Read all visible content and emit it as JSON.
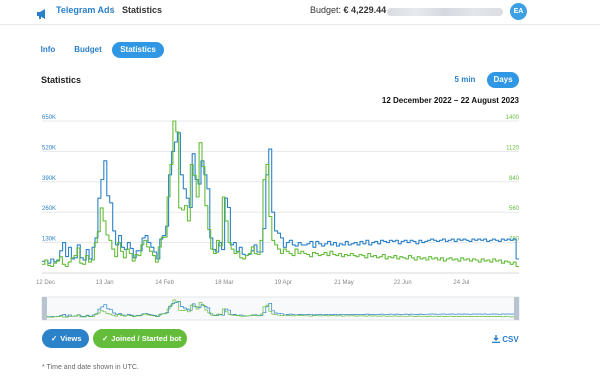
{
  "header": {
    "brand": "Telegram Ads",
    "separator": "/",
    "page": "Statistics",
    "budget_label": "Budget:",
    "budget_value": "€ 4,229.44",
    "avatar_initials": "EA"
  },
  "tabs": [
    {
      "label": "Info",
      "active": false
    },
    {
      "label": "Budget",
      "active": false
    },
    {
      "label": "Statistics",
      "active": true
    }
  ],
  "section_title": "Statistics",
  "granularity": {
    "options": [
      "5 min",
      "Days"
    ],
    "selected": "Days"
  },
  "date_range": "12 December 2022 – 22 August 2023",
  "chart_data": {
    "type": "line",
    "left_axis": {
      "ticks": [
        "130K",
        "260K",
        "390K",
        "520K",
        "650K"
      ],
      "range": [
        0,
        650000
      ],
      "color": "#2b82c9"
    },
    "right_axis": {
      "ticks": [
        "280",
        "560",
        "840",
        "1120",
        "1400"
      ],
      "range": [
        0,
        1400
      ],
      "color": "#64bd3a"
    },
    "x_ticks": [
      "12 Dec",
      "13 Jan",
      "14 Feb",
      "18 Mar",
      "19 Apr",
      "21 May",
      "22 Jun",
      "24 Jul"
    ],
    "grid": true,
    "series": [
      {
        "name": "Views",
        "color": "#2b82c9",
        "axis": "left",
        "values": [
          50000,
          55000,
          42000,
          60000,
          48000,
          55000,
          95000,
          130000,
          70000,
          110000,
          60000,
          65000,
          120000,
          65000,
          55000,
          100000,
          60000,
          110000,
          150000,
          320000,
          400000,
          480000,
          330000,
          300000,
          180000,
          120000,
          160000,
          110000,
          100000,
          130000,
          105000,
          65000,
          95000,
          95000,
          150000,
          160000,
          130000,
          110000,
          90000,
          60000,
          145000,
          160000,
          200000,
          420000,
          520000,
          560000,
          600000,
          420000,
          360000,
          320000,
          280000,
          510000,
          400000,
          380000,
          480000,
          420000,
          360000,
          150000,
          100000,
          90000,
          130000,
          100000,
          320000,
          280000,
          120000,
          130000,
          90000,
          110000,
          80000,
          75000,
          80000,
          95000,
          120000,
          90000,
          90000,
          190000,
          420000,
          530000,
          260000,
          180000,
          170000,
          150000,
          110000,
          130000,
          140000,
          120000,
          115000,
          130000,
          120000,
          120000,
          125000,
          135000,
          110000,
          135000,
          125000,
          115000,
          125000,
          135000,
          120000,
          130000,
          115000,
          125000,
          120000,
          135000,
          120000,
          125000,
          130000,
          120000,
          135000,
          125000,
          140000,
          120000,
          130000,
          135000,
          125000,
          140000,
          135000,
          130000,
          140000,
          135000,
          140000,
          125000,
          135000,
          140000,
          130000,
          140000,
          135000,
          125000,
          140000,
          130000,
          135000,
          140000,
          145000,
          140000,
          135000,
          140000,
          145000,
          135000,
          140000,
          145000,
          135000,
          145000,
          140000,
          145000,
          140000,
          135000,
          145000,
          140000,
          145000,
          140000,
          145000,
          135000,
          140000,
          145000,
          140000,
          135000,
          145000,
          140000,
          145000,
          140000,
          145000,
          60000
        ]
      },
      {
        "name": "Joined / Started bot",
        "color": "#64bd3a",
        "axis": "right",
        "values": [
          80,
          120,
          70,
          60,
          90,
          110,
          150,
          80,
          60,
          100,
          140,
          160,
          230,
          90,
          80,
          160,
          100,
          120,
          280,
          380,
          600,
          480,
          350,
          300,
          220,
          150,
          280,
          200,
          140,
          220,
          180,
          110,
          170,
          160,
          260,
          300,
          240,
          200,
          160,
          100,
          240,
          330,
          330,
          700,
          1000,
          1400,
          1300,
          600,
          580,
          620,
          480,
          1000,
          900,
          700,
          1200,
          980,
          620,
          400,
          220,
          180,
          300,
          250,
          700,
          480,
          280,
          220,
          180,
          200,
          140,
          130,
          160,
          180,
          240,
          180,
          170,
          300,
          860,
          1000,
          520,
          300,
          260,
          220,
          180,
          220,
          200,
          180,
          160,
          220,
          180,
          200,
          180,
          170,
          150,
          190,
          180,
          160,
          170,
          190,
          160,
          200,
          170,
          160,
          180,
          150,
          170,
          160,
          180,
          160,
          150,
          170,
          160,
          140,
          180,
          150,
          160,
          140,
          150,
          170,
          130,
          150,
          140,
          160,
          130,
          150,
          140,
          130,
          160,
          140,
          120,
          150,
          130,
          140,
          120,
          150,
          130,
          140,
          120,
          140,
          110,
          130,
          140,
          120,
          130,
          110,
          140,
          120,
          130,
          110,
          130,
          120,
          100,
          130,
          110,
          120,
          100,
          130,
          110,
          120,
          90,
          110,
          100,
          80,
          100,
          60
        ]
      }
    ]
  },
  "legend": {
    "views_label": "Views",
    "joined_label": "Joined / Started bot",
    "check_glyph": "✓"
  },
  "csv_label": "CSV",
  "footnote": "* Time and date shown in UTC."
}
